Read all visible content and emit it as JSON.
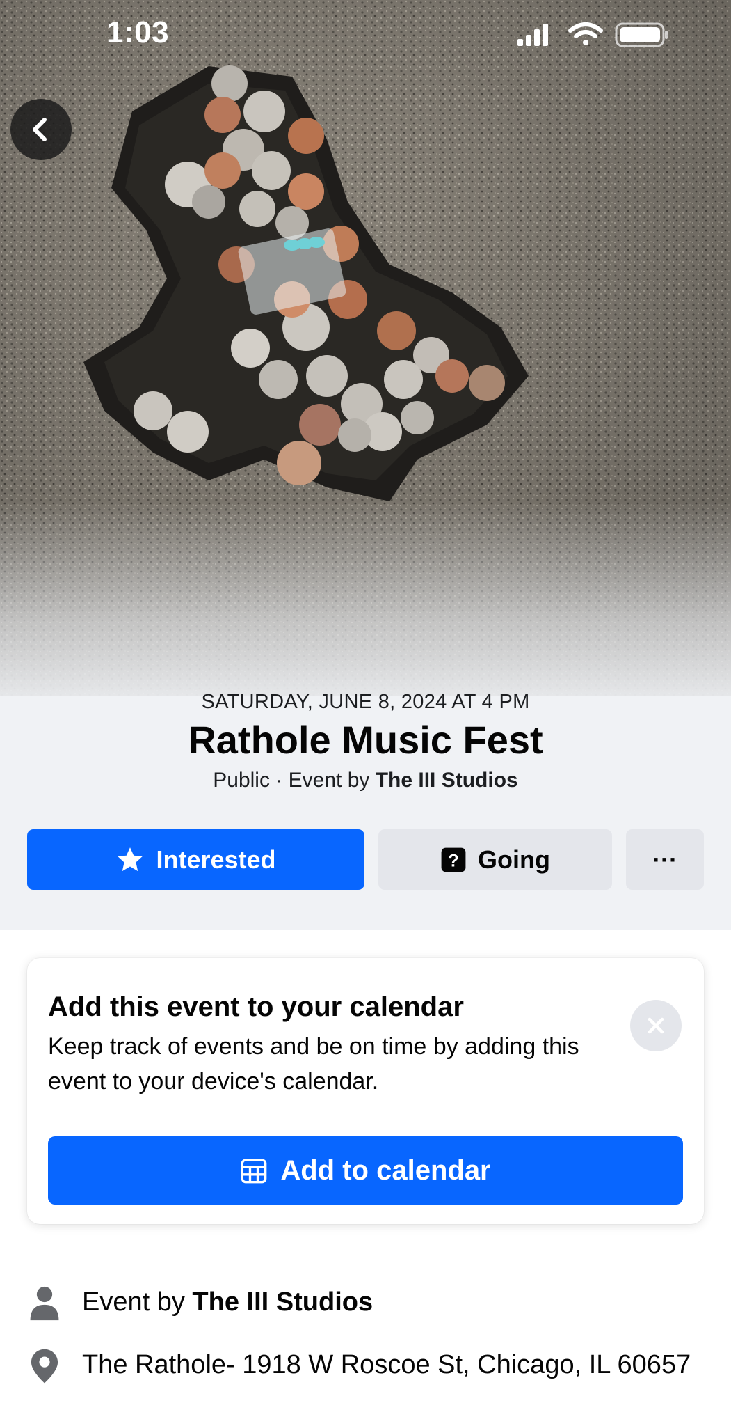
{
  "status_bar": {
    "time": "1:03",
    "icons": [
      "cellular-signal-icon",
      "wifi-icon",
      "battery-icon"
    ]
  },
  "hero": {
    "description_icon": "event-cover-photo"
  },
  "event": {
    "date": "SATURDAY, JUNE 8, 2024 AT 4 PM",
    "title": "Rathole Music Fest",
    "privacy": "Public",
    "separator": " · ",
    "event_by_prefix": "Event by ",
    "host": "The III Studios"
  },
  "actions": {
    "interested_label": "Interested",
    "going_label": "Going",
    "more_label": "···"
  },
  "calendar_card": {
    "title": "Add this event to your calendar",
    "body": "Keep track of events and be on time by adding this event to your device's calendar.",
    "button_label": "Add to calendar"
  },
  "details": {
    "host_prefix": "Event by ",
    "host_name": "The III Studios",
    "location": "The Rathole- 1918 W Roscoe St, Chicago, IL 60657"
  },
  "colors": {
    "primary_blue": "#0866ff",
    "secondary_gray": "#e4e6eb",
    "page_gray": "#f0f2f5",
    "text": "#050505"
  }
}
